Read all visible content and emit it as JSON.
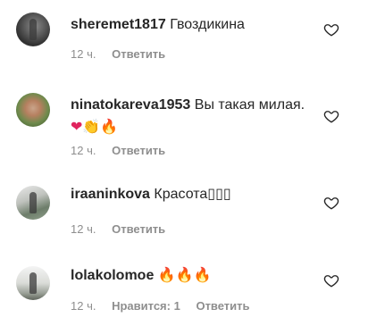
{
  "comments": [
    {
      "username": "sheremet1817",
      "text": "Гвоздикина",
      "emojis": [],
      "time": "12 ч.",
      "likes": "",
      "reply": "Ответить"
    },
    {
      "username": "ninatokareva1953",
      "text": "Вы такая милая.",
      "emojis": [
        "❤",
        "👏",
        "🔥"
      ],
      "time": "12 ч.",
      "likes": "",
      "reply": "Ответить"
    },
    {
      "username": "iraaninkova",
      "text": "Красота▯▯▯",
      "emojis": [],
      "time": "12 ч.",
      "likes": "",
      "reply": "Ответить"
    },
    {
      "username": "lolakolomoe",
      "text": "",
      "emojis": [
        "🔥",
        "🔥",
        "🔥"
      ],
      "time": "12 ч.",
      "likes": "Нравится: 1",
      "reply": "Ответить"
    }
  ],
  "icons": {
    "like": "heart-outline-icon",
    "avatar": "user-avatar"
  },
  "colors": {
    "text": "#262626",
    "meta": "#8e8e8e",
    "heart": "#e0245e",
    "fire": "#f26a1b",
    "clap": "#f3b232"
  }
}
